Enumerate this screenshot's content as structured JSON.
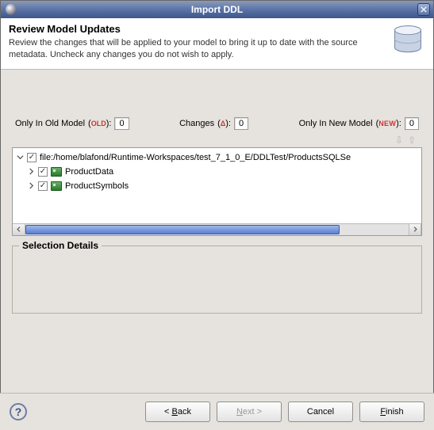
{
  "window": {
    "title": "Import DDL"
  },
  "banner": {
    "heading": "Review Model Updates",
    "description": "Review the changes that will be applied to your model to bring it up to date with the source metadata. Uncheck any changes you do not wish to apply."
  },
  "counts": {
    "only_old_label": "Only In Old Model",
    "only_old_tag": "OLD",
    "only_old_value": "0",
    "changes_label": "Changes",
    "changes_tag": "Δ",
    "changes_value": "0",
    "only_new_label": "Only In New Model",
    "only_new_tag": "NEW",
    "only_new_value": "0"
  },
  "tree": {
    "root": {
      "checked": true,
      "expanded": true,
      "label": "file:/home/blafond/Runtime-Workspaces/test_7_1_0_E/DDLTest/ProductsSQLSe"
    },
    "items": [
      {
        "checked": true,
        "expanded": false,
        "label": "ProductData"
      },
      {
        "checked": true,
        "expanded": false,
        "label": "ProductSymbols"
      }
    ]
  },
  "details": {
    "legend": "Selection Details"
  },
  "buttons": {
    "help": "?",
    "back": "< Back",
    "next": "Next >",
    "cancel": "Cancel",
    "finish": "Finish"
  }
}
